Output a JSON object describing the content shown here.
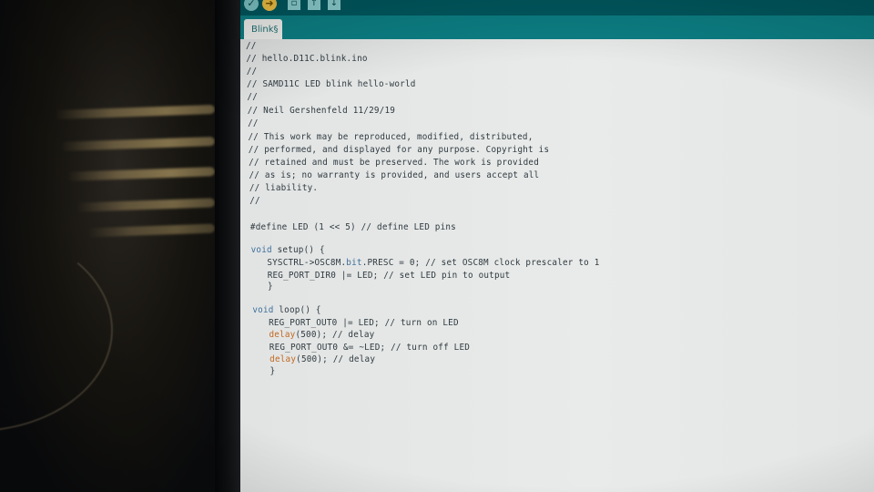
{
  "tab": {
    "label": "Blink§"
  },
  "toolbar": {
    "verify_icon": "check-icon",
    "upload_icon": "arrow-right-icon",
    "new_icon": "new-file-icon",
    "open_icon": "open-arrow-up-icon",
    "save_icon": "save-arrow-down-icon"
  },
  "colors": {
    "toolbar": "#00585f",
    "tabbar": "#0c7f84",
    "editor_bg": "#e6e8e7",
    "keyword": "#3d6f9a",
    "function": "#c2681f"
  },
  "code_lines": [
    "//",
    "// hello.D11C.blink.ino",
    "//",
    "// SAMD11C LED blink hello-world",
    "//",
    "// Neil Gershenfeld 11/29/19",
    "//",
    "// This work may be reproduced, modified, distributed,",
    "// performed, and displayed for any purpose. Copyright is",
    "// retained and must be preserved. The work is provided",
    "// as is; no warranty is provided, and users accept all",
    "// liability.",
    "//",
    "",
    "#define LED (1 << 5) // define LED pins",
    "",
    "void setup() {",
    "   SYSCTRL->OSC8M.bit.PRESC = 0; // set OSC8M clock prescaler to 1",
    "   REG_PORT_DIR0 |= LED; // set LED pin to output",
    "   }",
    "",
    "void loop() {",
    "   REG_PORT_OUT0 |= LED; // turn on LED",
    "   delay(500); // delay",
    "   REG_PORT_OUT0 &= ~LED; // turn off LED",
    "   delay(500); // delay",
    "   }"
  ]
}
